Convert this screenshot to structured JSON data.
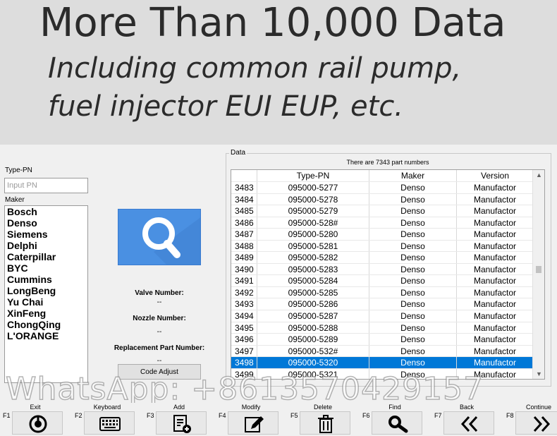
{
  "banner": {
    "title": "More Than 10,000 Data",
    "subtitle_line1": "Including common rail pump,",
    "subtitle_line2": "fuel injector EUI EUP, etc."
  },
  "left": {
    "type_pn_label": "Type-PN",
    "type_pn_placeholder": "Input PN",
    "type_pn_value": "",
    "maker_label": "Maker",
    "makers": [
      "Bosch",
      "Denso",
      "Siemens",
      "Delphi",
      "Caterpillar",
      "BYC",
      "Cummins",
      "LongBeng",
      "Yu Chai",
      "XinFeng",
      "ChongQing",
      "L'ORANGE"
    ]
  },
  "middle": {
    "search_icon": "magnifier-icon",
    "valve_number_label": "Valve Number:",
    "valve_number_value": "--",
    "nozzle_number_label": "Nozzle Number:",
    "nozzle_number_value": "--",
    "replacement_label": "Replacement Part Number:",
    "replacement_value": "--",
    "code_adjust_label": "Code Adjust"
  },
  "data_panel": {
    "legend": "Data",
    "count_text": "There are 7343 part numbers",
    "columns": [
      "",
      "Type-PN",
      "Maker",
      "Version"
    ],
    "rows": [
      [
        "3483",
        "095000-5277",
        "Denso",
        "Manufactor"
      ],
      [
        "3484",
        "095000-5278",
        "Denso",
        "Manufactor"
      ],
      [
        "3485",
        "095000-5279",
        "Denso",
        "Manufactor"
      ],
      [
        "3486",
        "095000-528#",
        "Denso",
        "Manufactor"
      ],
      [
        "3487",
        "095000-5280",
        "Denso",
        "Manufactor"
      ],
      [
        "3488",
        "095000-5281",
        "Denso",
        "Manufactor"
      ],
      [
        "3489",
        "095000-5282",
        "Denso",
        "Manufactor"
      ],
      [
        "3490",
        "095000-5283",
        "Denso",
        "Manufactor"
      ],
      [
        "3491",
        "095000-5284",
        "Denso",
        "Manufactor"
      ],
      [
        "3492",
        "095000-5285",
        "Denso",
        "Manufactor"
      ],
      [
        "3493",
        "095000-5286",
        "Denso",
        "Manufactor"
      ],
      [
        "3494",
        "095000-5287",
        "Denso",
        "Manufactor"
      ],
      [
        "3495",
        "095000-5288",
        "Denso",
        "Manufactor"
      ],
      [
        "3496",
        "095000-5289",
        "Denso",
        "Manufactor"
      ],
      [
        "3497",
        "095000-532#",
        "Denso",
        "Manufactor"
      ],
      [
        "3498",
        "095000-5320",
        "Denso",
        "Manufactor"
      ],
      [
        "3499",
        "095000-5321",
        "Denso",
        "Manufactor"
      ]
    ],
    "selected_row": "3498",
    "selected_color": "#0078d7"
  },
  "watermark": "WhatsApp:  +8613570429157",
  "function_keys": [
    {
      "code": "F1",
      "label": "Exit",
      "icon": "power-icon"
    },
    {
      "code": "F2",
      "label": "Keyboard",
      "icon": "keyboard-icon"
    },
    {
      "code": "F3",
      "label": "Add",
      "icon": "add-document-icon"
    },
    {
      "code": "F4",
      "label": "Modify",
      "icon": "edit-icon"
    },
    {
      "code": "F5",
      "label": "Delete",
      "icon": "trash-icon"
    },
    {
      "code": "F6",
      "label": "Find",
      "icon": "search-icon"
    },
    {
      "code": "F7",
      "label": "Back",
      "icon": "double-chevron-left-icon"
    },
    {
      "code": "F8",
      "label": "Continue",
      "icon": "double-chevron-right-icon"
    }
  ],
  "colors": {
    "banner_bg": "#dddddd",
    "search_tile": "#4a90e2",
    "selection": "#0078d7"
  }
}
